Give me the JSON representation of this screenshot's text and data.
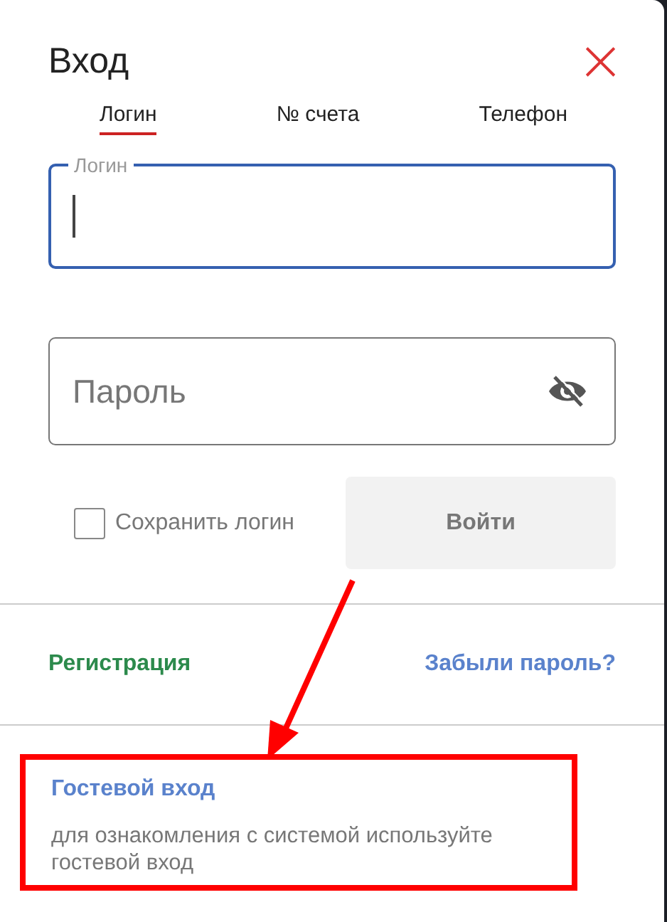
{
  "dialog": {
    "title": "Вход",
    "close": "×"
  },
  "tabs": [
    {
      "label": "Логин",
      "selected": true
    },
    {
      "label": "№ счета",
      "selected": false
    },
    {
      "label": "Телефон",
      "selected": false
    }
  ],
  "login_field": {
    "label": "Логин",
    "focused": true
  },
  "password_field": {
    "placeholder": "Пароль",
    "visible": false
  },
  "remember": {
    "label": "Сохранить логин",
    "checked": false
  },
  "submit": {
    "label": "Войти",
    "disabled": true
  },
  "links": [
    {
      "label": "Регистрация",
      "kind": "register"
    },
    {
      "label": "Забыли пароль?",
      "kind": "forgot"
    }
  ],
  "guest": {
    "title": "Гостевой вход",
    "text": "для ознакомления с системой используйте гостевой вход",
    "highlighted": true
  },
  "annotation_arrow": true
}
